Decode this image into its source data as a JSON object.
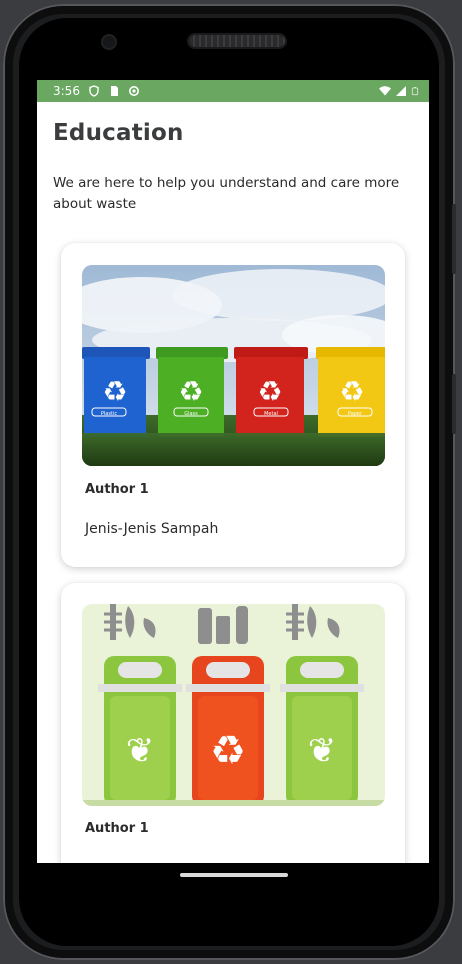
{
  "status_bar": {
    "time": "3:56",
    "left_icons": [
      "shield-icon",
      "sd-card-icon",
      "sync-icon"
    ],
    "right_icons": [
      "wifi-icon",
      "signal-icon",
      "battery-icon"
    ],
    "color": "#6aa862"
  },
  "page": {
    "title": "Education",
    "subtitle": "We are here to help you understand and care more about waste"
  },
  "articles": [
    {
      "author": "Author 1",
      "title": "Jenis-Jenis Sampah",
      "image": "recycling-bins-photo"
    },
    {
      "author": "Author 1",
      "title": "",
      "image": "waste-bins-illustration"
    }
  ],
  "bin_labels": [
    "Plastic",
    "Glass",
    "Metal",
    "Paper"
  ]
}
